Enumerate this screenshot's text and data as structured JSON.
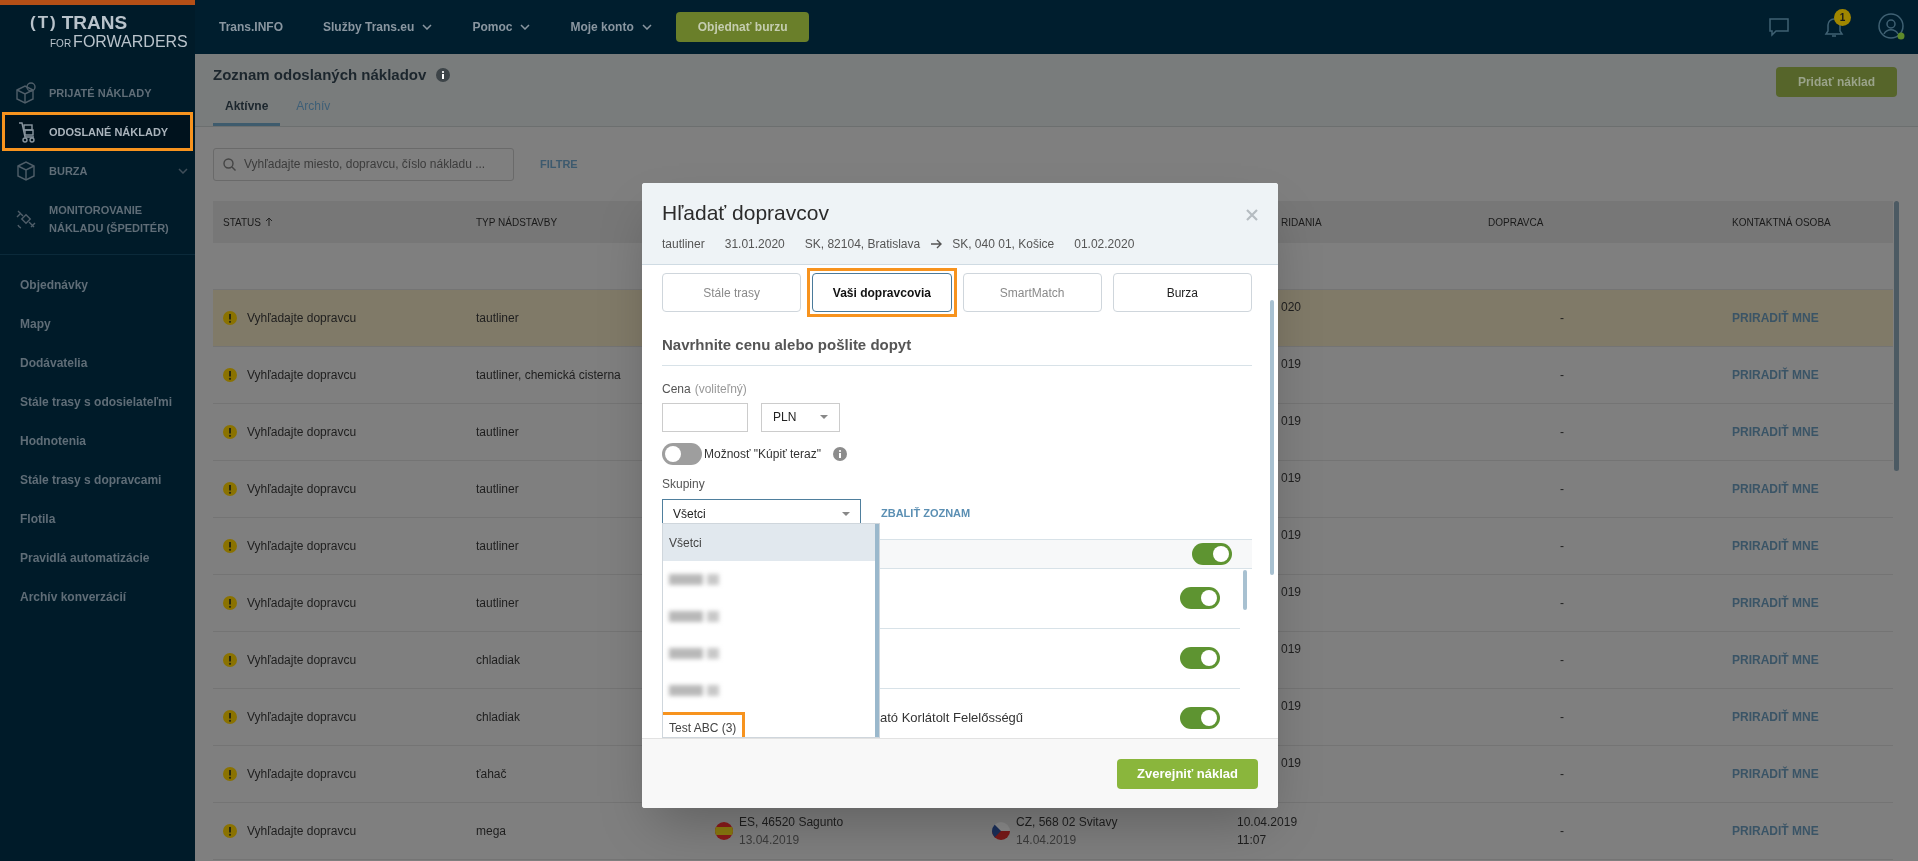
{
  "topbar": {
    "logo": {
      "mark": "(T)",
      "name": "TRANS",
      "small": "FOR",
      "sub": "FORWARDERS"
    },
    "nav": [
      {
        "label": "Trans.INFO",
        "dropdown": false
      },
      {
        "label": "Služby Trans.eu",
        "dropdown": true
      },
      {
        "label": "Pomoc",
        "dropdown": true
      },
      {
        "label": "Moje konto",
        "dropdown": true
      }
    ],
    "order_button": "Objednať burzu",
    "notifications_badge": "1"
  },
  "sidebar": {
    "main": [
      {
        "label": "PRIJATÉ NÁKLADY",
        "selected": false,
        "highlighted": false,
        "expandable": false
      },
      {
        "label": "ODOSLANÉ NÁKLADY",
        "selected": true,
        "highlighted": true,
        "expandable": false
      },
      {
        "label": "BURZA",
        "selected": false,
        "highlighted": false,
        "expandable": true
      },
      {
        "label": "MONITOROVANIE NÁKLADU (ŠPEDITÉR)",
        "selected": false,
        "highlighted": false,
        "expandable": false
      }
    ],
    "links": [
      "Objednávky",
      "Mapy",
      "Dodávatelia",
      "Stále trasy s odosielateľmi",
      "Hodnotenia",
      "Stále trasy s dopravcami",
      "Flotila",
      "Pravidlá automatizácie",
      "Archív konverzácií"
    ]
  },
  "page": {
    "title": "Zoznam odoslaných nákladov",
    "add_button": "Pridať náklad",
    "tabs": [
      {
        "label": "Aktívne",
        "selected": true
      },
      {
        "label": "Archív",
        "selected": false
      }
    ],
    "search": {
      "placeholder": "Vyhľadajte miesto, dopravcu, číslo nákladu ..."
    },
    "filter_link": "FILTRE"
  },
  "table": {
    "columns": {
      "status": "STATUS",
      "status_sorted": true,
      "body_type": "TYP NÁDSTAVBY",
      "column_5": "RIDANIA",
      "carrier": "DOPRAVCA",
      "contact": "KONTAKTNÁ OSOBA"
    },
    "rows": [
      {
        "status": "Vyhľadajte dopravcu",
        "body_type": "tautliner",
        "highlighted": true,
        "column_5": [
          "020"
        ],
        "carrier": "-",
        "contact": "PRIRADIŤ MNE"
      },
      {
        "status": "Vyhľadajte dopravcu",
        "body_type": "tautliner, chemická cisterna",
        "highlighted": false,
        "column_5": [
          "019"
        ],
        "carrier": "-",
        "contact": "PRIRADIŤ MNE"
      },
      {
        "status": "Vyhľadajte dopravcu",
        "body_type": "tautliner",
        "highlighted": false,
        "column_5": [
          "019"
        ],
        "carrier": "-",
        "contact": "PRIRADIŤ MNE"
      },
      {
        "status": "Vyhľadajte dopravcu",
        "body_type": "tautliner",
        "highlighted": false,
        "column_5": [
          "019"
        ],
        "carrier": "-",
        "contact": "PRIRADIŤ MNE"
      },
      {
        "status": "Vyhľadajte dopravcu",
        "body_type": "tautliner",
        "highlighted": false,
        "column_5": [
          "019"
        ],
        "carrier": "-",
        "contact": "PRIRADIŤ MNE"
      },
      {
        "status": "Vyhľadajte dopravcu",
        "body_type": "tautliner",
        "highlighted": false,
        "column_5": [
          "019"
        ],
        "carrier": "-",
        "contact": "PRIRADIŤ MNE"
      },
      {
        "status": "Vyhľadajte dopravcu",
        "body_type": "chladiak",
        "highlighted": false,
        "column_5": [
          "019"
        ],
        "carrier": "-",
        "contact": "PRIRADIŤ MNE"
      },
      {
        "status": "Vyhľadajte dopravcu",
        "body_type": "chladiak",
        "highlighted": false,
        "column_5": [
          "019"
        ],
        "carrier": "-",
        "contact": "PRIRADIŤ MNE"
      },
      {
        "status": "Vyhľadajte dopravcu",
        "body_type": "ťahač",
        "highlighted": false,
        "column_5": [
          "019"
        ],
        "carrier": "-",
        "contact": "PRIRADIŤ MNE"
      },
      {
        "status": "Vyhľadajte dopravcu",
        "body_type": "mega",
        "highlighted": false,
        "loading": {
          "place": "ES, 46520 Sagunto",
          "date": "13.04.2019"
        },
        "unloading": {
          "place": "CZ, 568 02 Svitavy",
          "date": "14.04.2019"
        },
        "column_5": [
          "10.04.2019",
          "11:07"
        ],
        "carrier": "-",
        "contact": "PRIRADIŤ MNE"
      }
    ]
  },
  "modal": {
    "title": "Hľadať dopravcov",
    "summary": {
      "body_type": "tautliner",
      "loading_date": "31.01.2020",
      "from": "SK, 82104, Bratislava",
      "to": "SK, 040 01, Košice",
      "unloading_date": "01.02.2020"
    },
    "tabs": [
      {
        "label": "Stále trasy",
        "selected": false,
        "disabled": true,
        "highlighted": false
      },
      {
        "label": "Vaši dopravcovia",
        "selected": true,
        "disabled": false,
        "highlighted": true
      },
      {
        "label": "SmartMatch",
        "selected": false,
        "disabled": true,
        "highlighted": false
      },
      {
        "label": "Burza",
        "selected": false,
        "disabled": false,
        "highlighted": false
      }
    ],
    "section_title": "Navrhnite cenu alebo pošlite dopyt",
    "price": {
      "label": "Cena",
      "hint": "(voliteľný)",
      "currency": "PLN"
    },
    "buy_now": {
      "label": "Možnosť \"Kúpiť teraz\"",
      "on": false
    },
    "groups": {
      "label": "Skupiny",
      "value": "Všetci",
      "collapse_link": "ZBALIŤ ZOZNAM",
      "options": [
        {
          "kind": "text",
          "label": "Všetci",
          "selected": true,
          "highlighted": false
        },
        {
          "kind": "redacted",
          "selected": false,
          "highlighted": false
        },
        {
          "kind": "redacted",
          "selected": false,
          "highlighted": false
        },
        {
          "kind": "redacted",
          "selected": false,
          "highlighted": false
        },
        {
          "kind": "redacted",
          "selected": false,
          "highlighted": false
        },
        {
          "kind": "text",
          "label": "Test ABC (3)",
          "selected": false,
          "highlighted": true
        }
      ]
    },
    "carriers": {
      "all_on": true,
      "rows": [
        {
          "on": true
        },
        {
          "on": true
        },
        {
          "name": "ató Korlátolt Felelősségű",
          "on": true
        }
      ]
    },
    "publish_button": "Zverejniť náklad"
  }
}
